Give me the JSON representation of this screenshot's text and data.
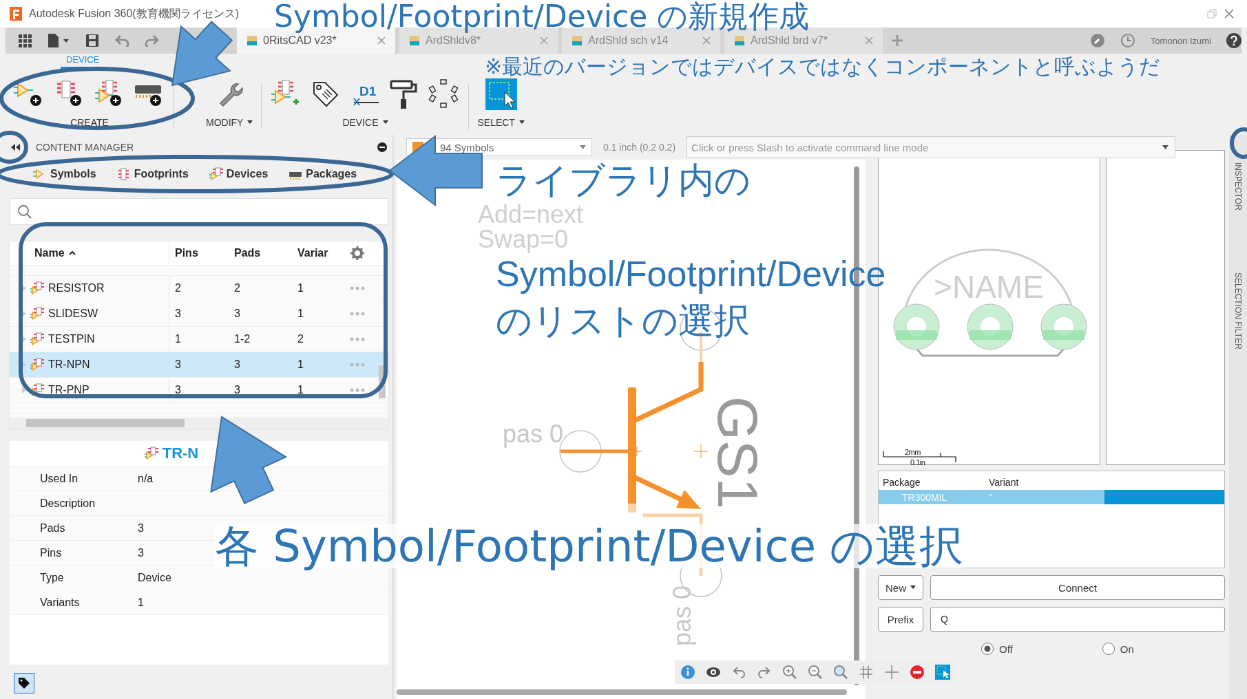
{
  "window": {
    "title": "Autodesk Fusion 360(教育機関ライセンス)"
  },
  "document_tabs": [
    {
      "label": "0RitsCAD v23*",
      "selected": true
    },
    {
      "label": "ArdShldv8*",
      "selected": false
    },
    {
      "label": "ArdShld sch v14",
      "selected": false
    },
    {
      "label": "ArdShld brd v7*",
      "selected": false
    }
  ],
  "account": {
    "user": "Tomonori Izumi"
  },
  "ribbon": {
    "tab": "DEVICE",
    "groups": [
      {
        "label": "CREATE",
        "dropdown": false,
        "tools": [
          {
            "kind": "symbol"
          },
          {
            "kind": "footprint"
          },
          {
            "kind": "device"
          },
          {
            "kind": "package"
          }
        ]
      },
      {
        "label": "MODIFY",
        "dropdown": true,
        "tools": [
          {
            "kind": "wrench"
          }
        ]
      },
      {
        "label": "DEVICE",
        "dropdown": true,
        "tools": [
          {
            "kind": "connect"
          },
          {
            "kind": "tag"
          },
          {
            "kind": "name",
            "text": "D1"
          },
          {
            "kind": "paint"
          },
          {
            "kind": "pads"
          }
        ]
      },
      {
        "label": "SELECT",
        "dropdown": true,
        "tools": [
          {
            "kind": "select"
          }
        ]
      }
    ]
  },
  "content_manager": {
    "title": "CONTENT MANAGER",
    "tabs": [
      {
        "label": "Symbols",
        "kind": "symbol"
      },
      {
        "label": "Footprints",
        "kind": "footprint"
      },
      {
        "label": "Devices",
        "kind": "device"
      },
      {
        "label": "Packages",
        "kind": "package"
      }
    ],
    "table": {
      "columns": [
        "Name",
        "Pins",
        "Pads",
        "Variar"
      ],
      "rows": [
        {
          "name": "RESISTOR",
          "pins": "2",
          "pads": "2",
          "variants": "1",
          "selected": false
        },
        {
          "name": "SLIDESW",
          "pins": "3",
          "pads": "3",
          "variants": "1",
          "selected": false
        },
        {
          "name": "TESTPIN",
          "pins": "1",
          "pads": "1-2",
          "variants": "2",
          "selected": false
        },
        {
          "name": "TR-NPN",
          "pins": "3",
          "pads": "3",
          "variants": "1",
          "selected": true
        },
        {
          "name": "TR-PNP",
          "pins": "3",
          "pads": "3",
          "variants": "1",
          "selected": false
        }
      ]
    },
    "details": {
      "title": "TR-N",
      "fields": [
        {
          "label": "Used In",
          "value": "n/a"
        },
        {
          "label": "Description"
        },
        {
          "label": "Pads",
          "value": "3"
        },
        {
          "label": "Pins",
          "value": "3"
        },
        {
          "label": "Type",
          "value": "Device"
        },
        {
          "label": "Variants",
          "value": "1"
        }
      ]
    }
  },
  "canvas": {
    "symbols_dropdown": "94 Symbols",
    "grid": "0.1 inch (0.2 0.2)",
    "command_placeholder": "Click or press Slash to activate command line mode",
    "attributes": [
      "Add=next",
      "Swap=0"
    ],
    "pins": [
      "pas 0",
      "pas 0"
    ],
    "part_name": "GS1"
  },
  "preview": {
    "footprint_name": ">NAME",
    "scale": [
      "2mm",
      "0.1in"
    ]
  },
  "variants": {
    "columns": [
      "Package",
      "Variant"
    ],
    "rows": [
      {
        "package": "TR300MIL",
        "variant": "\"",
        "selected": true
      }
    ]
  },
  "actions": [
    {
      "kind": "dropdown",
      "label": "New"
    },
    {
      "kind": "wide",
      "label": "Connect"
    }
  ],
  "prefix": {
    "label": "Prefix",
    "value": "Q"
  },
  "radios": [
    {
      "label": "Off",
      "selected": true
    },
    {
      "label": "On",
      "selected": false
    }
  ],
  "side_panels": [
    "INSPECTOR",
    "SELECTION FILTER"
  ],
  "annotations": [
    {
      "kind": "title",
      "text": "Symbol/Footprint/Device の新規作成"
    },
    {
      "kind": "note",
      "text": "※最近のバージョンではデバイスではなくコンポーネントと呼ぶようだ"
    },
    {
      "kind": "list",
      "lines": [
        "ライブラリ内の",
        "Symbol/Footprint/Device",
        "のリストの選択"
      ]
    },
    {
      "kind": "item",
      "text": "各 Symbol/Footprint/Device の選択"
    }
  ]
}
